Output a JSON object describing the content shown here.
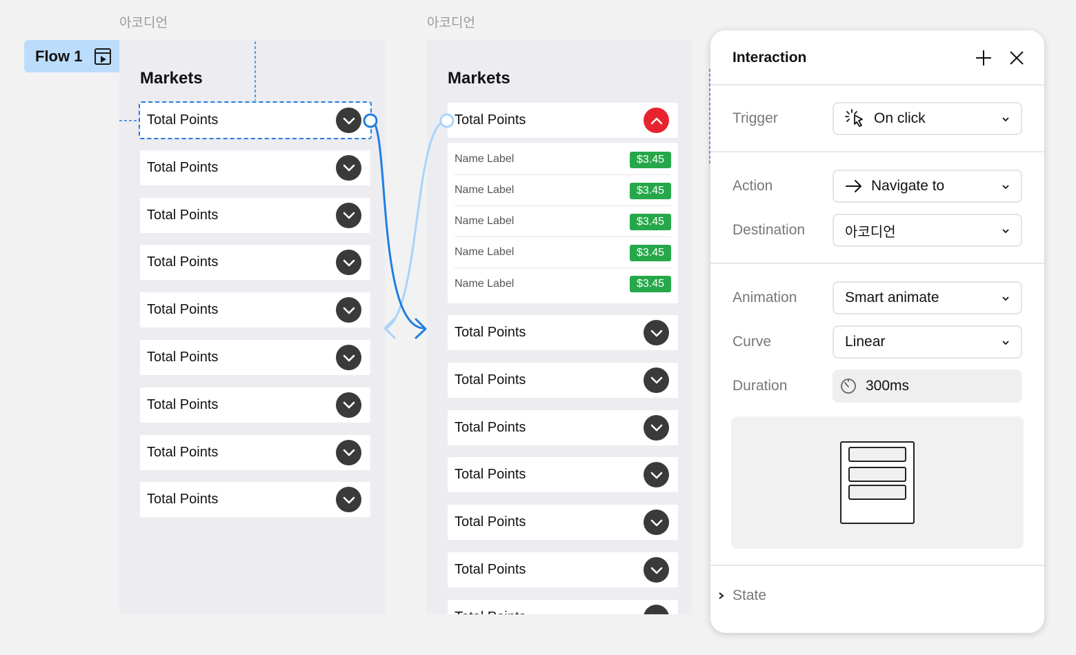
{
  "canvas": {
    "frame_label_1": "아코디언",
    "frame_label_2": "아코디언",
    "flow_label": "Flow 1"
  },
  "frame1": {
    "title": "Markets",
    "rows": [
      "Total Points",
      "Total Points",
      "Total Points",
      "Total Points",
      "Total Points",
      "Total Points",
      "Total Points",
      "Total Points",
      "Total Points"
    ]
  },
  "frame2": {
    "title": "Markets",
    "expanded_row": "Total Points",
    "sub_items": [
      {
        "label": "Name Label",
        "price": "$3.45"
      },
      {
        "label": "Name Label",
        "price": "$3.45"
      },
      {
        "label": "Name Label",
        "price": "$3.45"
      },
      {
        "label": "Name Label",
        "price": "$3.45"
      },
      {
        "label": "Name Label",
        "price": "$3.45"
      }
    ],
    "rows": [
      "Total Points",
      "Total Points",
      "Total Points",
      "Total Points",
      "Total Points",
      "Total Points",
      "Total Points"
    ]
  },
  "panel": {
    "title": "Interaction",
    "trigger_label": "Trigger",
    "trigger_value": "On click",
    "action_label": "Action",
    "action_value": "Navigate to",
    "destination_label": "Destination",
    "destination_value": "아코디언",
    "animation_label": "Animation",
    "animation_value": "Smart animate",
    "curve_label": "Curve",
    "curve_value": "Linear",
    "duration_label": "Duration",
    "duration_value": "300ms",
    "state_label": "State"
  },
  "colors": {
    "accent_blue": "#1f7ee0",
    "flow_badge": "#bcdcfb",
    "price_green": "#26a84a",
    "collapse_red": "#e8232f"
  },
  "icons": {
    "flow": "play-frame-icon",
    "add": "plus-icon",
    "close": "close-icon",
    "trigger": "click-cursor-icon",
    "action": "arrow-right-icon",
    "duration": "timer-icon",
    "state": "chevron-right-icon"
  }
}
